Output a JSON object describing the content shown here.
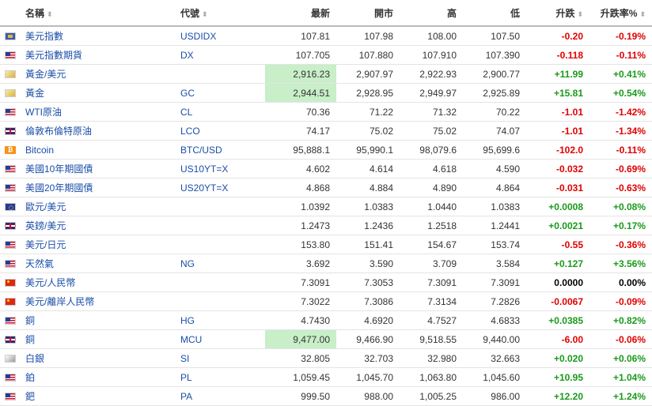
{
  "headers": {
    "name": "名稱",
    "symbol": "代號",
    "last": "最新",
    "open": "開市",
    "high": "高",
    "low": "低",
    "change": "升跌",
    "change_pct": "升跌率%"
  },
  "colors": {
    "up": "#1a9a1a",
    "down": "#e00000",
    "highlight": "#c8efc8",
    "link": "#1a4ea8"
  },
  "rows": [
    {
      "flag": "index-icon",
      "name": "美元指數",
      "symbol": "USDIDX",
      "last": "107.81",
      "open": "107.98",
      "high": "108.00",
      "low": "107.50",
      "change": "-0.20",
      "pct": "-0.19%",
      "dir": "down",
      "hl": false
    },
    {
      "flag": "us-flag-icon",
      "name": "美元指數期貨",
      "symbol": "DX",
      "last": "107.705",
      "open": "107.880",
      "high": "107.910",
      "low": "107.390",
      "change": "-0.118",
      "pct": "-0.11%",
      "dir": "down",
      "hl": false
    },
    {
      "flag": "gold-icon",
      "name": "黃金/美元",
      "symbol": "",
      "last": "2,916.23",
      "open": "2,907.97",
      "high": "2,922.93",
      "low": "2,900.77",
      "change": "+11.99",
      "pct": "+0.41%",
      "dir": "up",
      "hl": true
    },
    {
      "flag": "gold-icon",
      "name": "黃金",
      "symbol": "GC",
      "last": "2,944.51",
      "open": "2,928.95",
      "high": "2,949.97",
      "low": "2,925.89",
      "change": "+15.81",
      "pct": "+0.54%",
      "dir": "up",
      "hl": true
    },
    {
      "flag": "us-flag-icon",
      "name": "WTI原油",
      "symbol": "CL",
      "last": "70.36",
      "open": "71.22",
      "high": "71.32",
      "low": "70.22",
      "change": "-1.01",
      "pct": "-1.42%",
      "dir": "down",
      "hl": false
    },
    {
      "flag": "uk-flag-icon",
      "name": "倫敦布倫特原油",
      "symbol": "LCO",
      "last": "74.17",
      "open": "75.02",
      "high": "75.02",
      "low": "74.07",
      "change": "-1.01",
      "pct": "-1.34%",
      "dir": "down",
      "hl": false
    },
    {
      "flag": "bitcoin-icon",
      "name": "Bitcoin",
      "symbol": "BTC/USD",
      "last": "95,888.1",
      "open": "95,990.1",
      "high": "98,079.6",
      "low": "95,699.6",
      "change": "-102.0",
      "pct": "-0.11%",
      "dir": "down",
      "hl": false
    },
    {
      "flag": "us-flag-icon",
      "name": "美國10年期國債",
      "symbol": "US10YT=X",
      "last": "4.602",
      "open": "4.614",
      "high": "4.618",
      "low": "4.590",
      "change": "-0.032",
      "pct": "-0.69%",
      "dir": "down",
      "hl": false
    },
    {
      "flag": "us-flag-icon",
      "name": "美國20年期國債",
      "symbol": "US20YT=X",
      "last": "4.868",
      "open": "4.884",
      "high": "4.890",
      "low": "4.864",
      "change": "-0.031",
      "pct": "-0.63%",
      "dir": "down",
      "hl": false
    },
    {
      "flag": "eu-flag-icon",
      "name": "歐元/美元",
      "symbol": "",
      "last": "1.0392",
      "open": "1.0383",
      "high": "1.0440",
      "low": "1.0383",
      "change": "+0.0008",
      "pct": "+0.08%",
      "dir": "up",
      "hl": false
    },
    {
      "flag": "uk-flag-icon",
      "name": "英鎊/美元",
      "symbol": "",
      "last": "1.2473",
      "open": "1.2436",
      "high": "1.2518",
      "low": "1.2441",
      "change": "+0.0021",
      "pct": "+0.17%",
      "dir": "up",
      "hl": false
    },
    {
      "flag": "us-flag-icon",
      "name": "美元/日元",
      "symbol": "",
      "last": "153.80",
      "open": "151.41",
      "high": "154.67",
      "low": "153.74",
      "change": "-0.55",
      "pct": "-0.36%",
      "dir": "down",
      "hl": false
    },
    {
      "flag": "us-flag-icon",
      "name": "天然氣",
      "symbol": "NG",
      "last": "3.692",
      "open": "3.590",
      "high": "3.709",
      "low": "3.584",
      "change": "+0.127",
      "pct": "+3.56%",
      "dir": "up",
      "hl": false
    },
    {
      "flag": "cn-flag-icon",
      "name": "美元/人民幣",
      "symbol": "",
      "last": "7.3091",
      "open": "7.3053",
      "high": "7.3091",
      "low": "7.3091",
      "change": "0.0000",
      "pct": "0.00%",
      "dir": "flat",
      "hl": false
    },
    {
      "flag": "cn-flag-icon",
      "name": "美元/離岸人民幣",
      "symbol": "",
      "last": "7.3022",
      "open": "7.3086",
      "high": "7.3134",
      "low": "7.2826",
      "change": "-0.0067",
      "pct": "-0.09%",
      "dir": "down",
      "hl": false
    },
    {
      "flag": "us-flag-icon",
      "name": "銅",
      "symbol": "HG",
      "last": "4.7430",
      "open": "4.6920",
      "high": "4.7527",
      "low": "4.6833",
      "change": "+0.0385",
      "pct": "+0.82%",
      "dir": "up",
      "hl": false
    },
    {
      "flag": "uk-flag-icon",
      "name": "銅",
      "symbol": "MCU",
      "last": "9,477.00",
      "open": "9,466.90",
      "high": "9,518.55",
      "low": "9,440.00",
      "change": "-6.00",
      "pct": "-0.06%",
      "dir": "down",
      "hl": true
    },
    {
      "flag": "silver-icon",
      "name": "白銀",
      "symbol": "SI",
      "last": "32.805",
      "open": "32.703",
      "high": "32.980",
      "low": "32.663",
      "change": "+0.020",
      "pct": "+0.06%",
      "dir": "up",
      "hl": false
    },
    {
      "flag": "us-flag-icon",
      "name": "鉑",
      "symbol": "PL",
      "last": "1,059.45",
      "open": "1,045.70",
      "high": "1,063.80",
      "low": "1,045.60",
      "change": "+10.95",
      "pct": "+1.04%",
      "dir": "up",
      "hl": false
    },
    {
      "flag": "us-flag-icon",
      "name": "鈀",
      "symbol": "PA",
      "last": "999.50",
      "open": "988.00",
      "high": "1,005.25",
      "low": "986.00",
      "change": "+12.20",
      "pct": "+1.24%",
      "dir": "up",
      "hl": false
    }
  ]
}
